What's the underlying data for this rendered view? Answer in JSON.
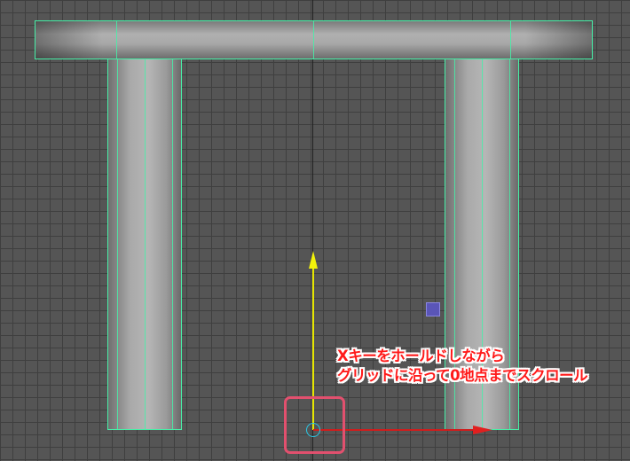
{
  "annotation": {
    "line1": "Xキーをホールドしながら",
    "line2": "グリッドに沿って0地点までスクロール"
  },
  "colors": {
    "grid_background": "#555555",
    "grid_lines": "#3f3f3f",
    "selection_wireframe": "#47f0a8",
    "y_axis": "#f2f20a",
    "x_axis": "#e11f1f",
    "pivot_circle": "#2ac8e6",
    "highlight_box": "#e2506e",
    "annotation_text": "#ff1a1a",
    "pivot_square": "#5a55b8"
  },
  "icons": {
    "move_y_arrow": "up-arrow-icon",
    "move_x_arrow": "right-arrow-icon",
    "pivot_origin": "circle-icon",
    "pivot_handle": "square-icon"
  }
}
